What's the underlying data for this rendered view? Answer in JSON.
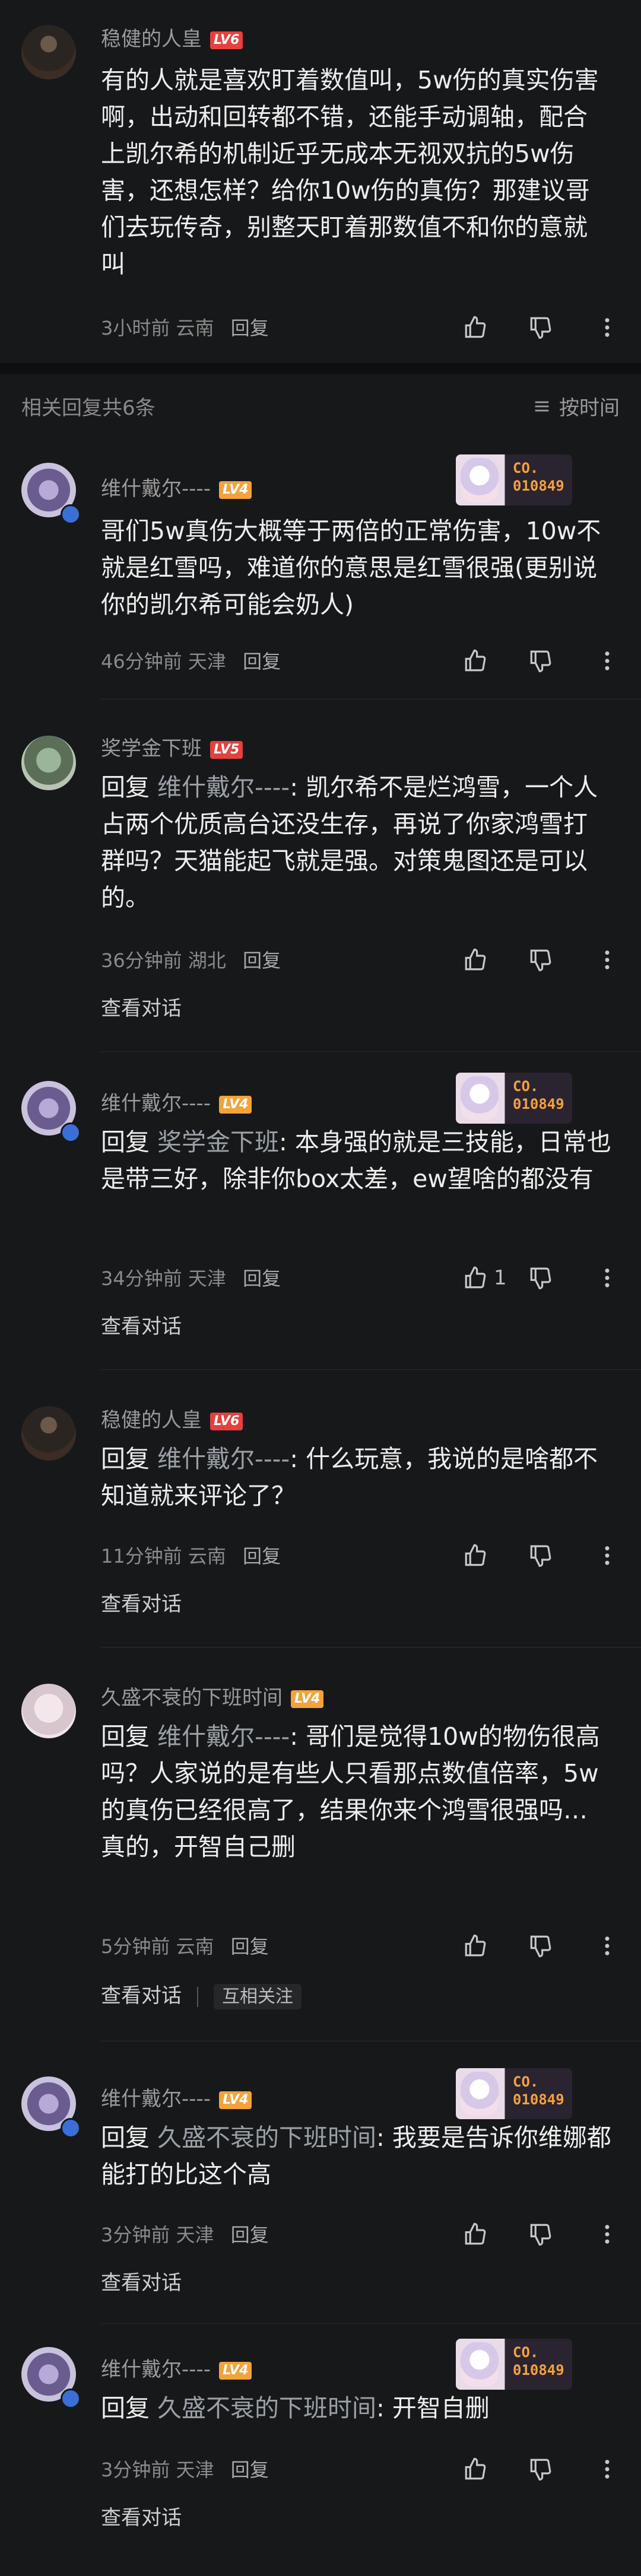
{
  "top_comment": {
    "user": "稳健的人皇",
    "level": "LV6",
    "text": "有的人就是喜欢盯着数值叫，5w伤的真实伤害啊，出动和回转都不错，还能手动调轴，配合上凯尔希的机制近乎无成本无视双抗的5w伤害，还想怎样？给你10w伤的真伤？那建议哥们去玩传奇，别整天盯着那数值不和你的意就叫",
    "time": "3小时前",
    "location": "云南",
    "reply_label": "回复"
  },
  "replies_header": {
    "count_label": "相关回复共6条",
    "sort_label": "按时间"
  },
  "replies": [
    {
      "user": "维什戴尔----",
      "level": "LV4",
      "deco_label": "CO.\n010849",
      "text": "哥们5w真伤大概等于两倍的正常伤害，10w不就是红雪吗，难道你的意思是红雪很强(更别说你的凯尔希可能会奶人)",
      "time": "46分钟前",
      "location": "天津",
      "reply_label": "回复"
    },
    {
      "user": "奖学金下班",
      "level": "LV5",
      "reply_prefix": "回复 ",
      "reply_target": "维什戴尔----",
      "text": ": 凯尔希不是烂鸿雪，一个人占两个优质高台还没生存，再说了你家鸿雪打群吗？天猫能起飞就是强。对策鬼图还是可以的。",
      "time": "36分钟前",
      "location": "湖北",
      "reply_label": "回复",
      "view_conv": "查看对话"
    },
    {
      "user": "维什戴尔----",
      "level": "LV4",
      "deco_label": "CO.\n010849",
      "reply_prefix": "回复 ",
      "reply_target": "奖学金下班",
      "text": ": 本身强的就是三技能，日常也是带三好，除非你box太差，ew望啥的都没有",
      "time": "34分钟前",
      "location": "天津",
      "reply_label": "回复",
      "like_count": "1",
      "view_conv": "查看对话"
    },
    {
      "user": "稳健的人皇",
      "level": "LV6",
      "reply_prefix": "回复 ",
      "reply_target": "维什戴尔----",
      "text": ": 什么玩意，我说的是啥都不知道就来评论了？",
      "time": "11分钟前",
      "location": "云南",
      "reply_label": "回复",
      "view_conv": "查看对话"
    },
    {
      "user": "久盛不衰的下班时间",
      "level": "LV4",
      "reply_prefix": "回复 ",
      "reply_target": "维什戴尔----",
      "text": ": 哥们是觉得10w的物伤很高吗？人家说的是有些人只看那点数值倍率，5w的真伤已经很高了，结果你来个鸿雪很强吗…",
      "text2": "真的，开智自己删",
      "time": "5分钟前",
      "location": "云南",
      "reply_label": "回复",
      "view_conv": "查看对话",
      "mutual": "互相关注"
    },
    {
      "user": "维什戴尔----",
      "level": "LV4",
      "deco_label": "CO.\n010849",
      "reply_prefix": "回复 ",
      "reply_target": "久盛不衰的下班时间",
      "text": ": 我要是告诉你维娜都能打的比这个高",
      "time": "3分钟前",
      "location": "天津",
      "reply_label": "回复",
      "view_conv": "查看对话"
    },
    {
      "user": "维什戴尔----",
      "level": "LV4",
      "deco_label": "CO.\n010849",
      "reply_prefix": "回复 ",
      "reply_target": "久盛不衰的下班时间",
      "text": ": 开智自删",
      "time": "3分钟前",
      "location": "天津",
      "reply_label": "回复",
      "view_conv": "查看对话"
    }
  ]
}
